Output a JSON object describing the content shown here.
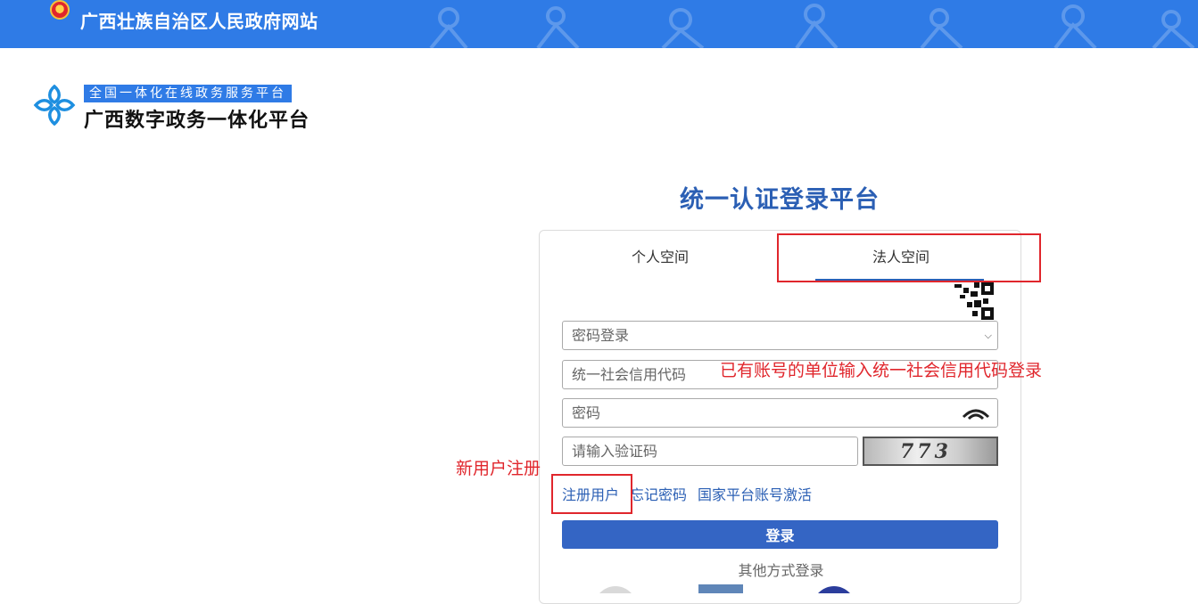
{
  "banner": {
    "title": "广西壮族自治区人民政府网站",
    "bg_color": "#2f7be6",
    "emblem_icon": "national-emblem-icon"
  },
  "platform": {
    "subtitle": "全国一体化在线政务服务平台",
    "name": "广西数字政务一体化平台",
    "logo_icon": "platform-logo-icon"
  },
  "login": {
    "heading": "统一认证登录平台",
    "tabs": [
      {
        "label": "个人空间",
        "active": false
      },
      {
        "label": "法人空间",
        "active": true
      }
    ],
    "qr_icon": "qr-code-icon",
    "method_select": {
      "value": "密码登录",
      "icon": "chevron-down-icon"
    },
    "credit_code": {
      "placeholder": "统一社会信用代码"
    },
    "password": {
      "placeholder": "密码",
      "icon": "eye-icon"
    },
    "captcha": {
      "placeholder": "请输入验证码",
      "image_text": "773"
    },
    "links": [
      "注册用户",
      "忘记密码",
      "国家平台账号激活"
    ],
    "submit_label": "登录",
    "other_methods_label": "其他方式登录",
    "accent_color": "#2b5fb4",
    "button_color": "#3465c4"
  },
  "annotations": {
    "credit_hint": "已有账号的单位输入统一社会信用代码登录",
    "new_user_hint": "新用户注册",
    "color": "#e0262c"
  }
}
